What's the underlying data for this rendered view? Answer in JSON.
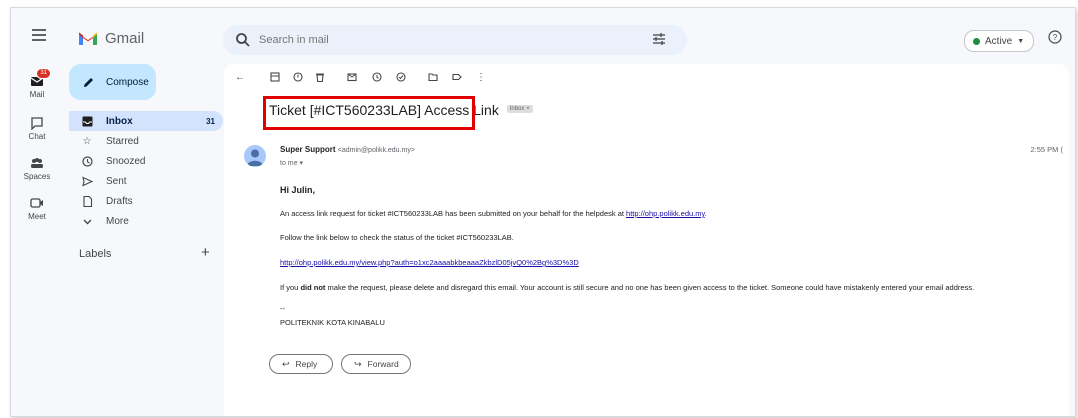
{
  "app": {
    "name": "Gmail",
    "search_placeholder": "Search in mail",
    "status_label": "Active",
    "colors": {
      "accent": "#0b57d0",
      "compose_bg": "#c2e7ff",
      "selected_bg": "#d3e3fd",
      "highlight_box": "#e00000",
      "status_green": "#1e8e3e"
    }
  },
  "rail": {
    "items": [
      {
        "label": "Mail",
        "icon": "mail-icon",
        "badge": "31"
      },
      {
        "label": "Chat",
        "icon": "chat-icon"
      },
      {
        "label": "Spaces",
        "icon": "spaces-icon"
      },
      {
        "label": "Meet",
        "icon": "meet-icon"
      }
    ]
  },
  "sidebar": {
    "compose_label": "Compose",
    "items": [
      {
        "label": "Inbox",
        "icon": "inbox-icon",
        "count": "31",
        "selected": true
      },
      {
        "label": "Starred",
        "icon": "star-icon"
      },
      {
        "label": "Snoozed",
        "icon": "clock-icon"
      },
      {
        "label": "Sent",
        "icon": "send-icon"
      },
      {
        "label": "Drafts",
        "icon": "draft-icon"
      },
      {
        "label": "More",
        "icon": "chevron-down-icon"
      }
    ],
    "labels_heading": "Labels"
  },
  "email": {
    "subject": "Ticket [#ICT560233LAB] Access Link",
    "folder_chip": "Inbox ×",
    "sender_name": "Super Support",
    "sender_email": "<admin@polikk.edu.my>",
    "recipient": "to me ▾",
    "time": "2:55 PM (",
    "greeting": "Hi Julin,",
    "line1_text": "An access link request for ticket #ICT560233LAB has been submitted on your behalf for the helpdesk at ",
    "line1_link": "http://ohp.polikk.edu.my",
    "line1_end": ".",
    "line2": "Follow the link below to check the status of the ticket #ICT560233LAB.",
    "status_link": "http://ohp.polikk.edu.my/view.php?auth=o1xc2aaaabkbeaaaZkbzlD05jvQ0%2Bg%3D%3D",
    "line4_a": "If you ",
    "line4_bold": "did not",
    "line4_b": " make the request, please delete and disregard this email. Your account is still secure and no one has been given access to the ticket. Someone could have mistakenly entered your email address.",
    "signature_sep": "--",
    "signature": "POLITEKNIK KOTA KINABALU",
    "reply_label": "Reply",
    "forward_label": "Forward"
  }
}
